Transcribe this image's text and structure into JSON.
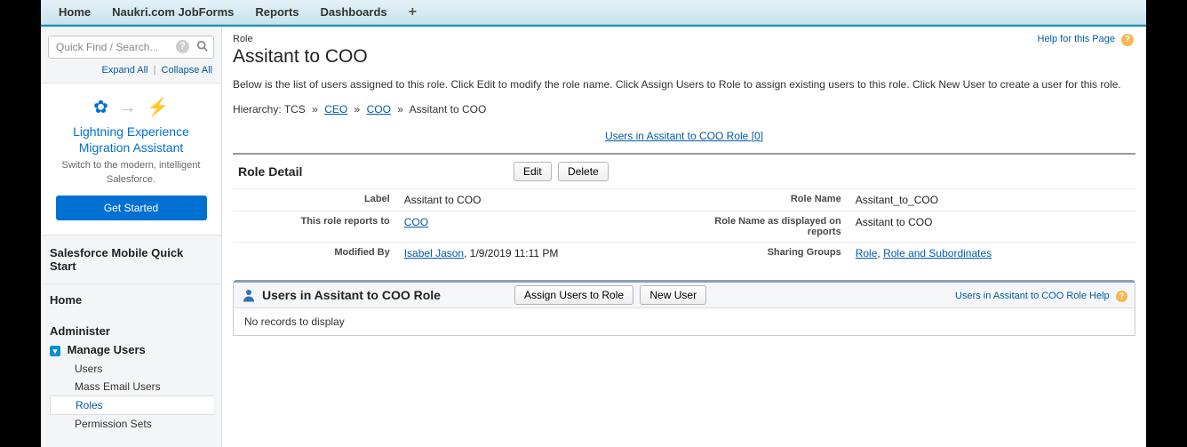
{
  "topnav": {
    "items": [
      "Home",
      "Naukri.com JobForms",
      "Reports",
      "Dashboards"
    ]
  },
  "search": {
    "placeholder": "Quick Find / Search..."
  },
  "expand": {
    "expand": "Expand All",
    "collapse": "Collapse All"
  },
  "migration": {
    "title": "Lightning Experience Migration Assistant",
    "subtitle": "Switch to the modern, intelligent Salesforce.",
    "cta": "Get Started"
  },
  "sfmqs": "Salesforce Mobile Quick Start",
  "sidenav": {
    "home": "Home",
    "administer": "Administer",
    "manage_users": "Manage Users",
    "items": [
      "Users",
      "Mass Email Users",
      "Roles",
      "Permission Sets"
    ],
    "active_index": 2
  },
  "page": {
    "help": "Help for this Page",
    "type_label": "Role",
    "title": "Assitant to COO",
    "description": "Below is the list of users assigned to this role. Click Edit to modify the role name. Click Assign Users to Role to assign existing users to this role. Click New User to create a user for this role.",
    "hierarchy": {
      "label": "Hierarchy:",
      "root": "TCS",
      "crumbs": [
        "CEO",
        "COO"
      ],
      "current": "Assitant to COO"
    },
    "users_link": "Users in Assitant to COO Role",
    "users_count": "[0]"
  },
  "detail": {
    "header": "Role Detail",
    "edit": "Edit",
    "delete": "Delete",
    "rows": {
      "label_lbl": "Label",
      "label_val": "Assitant to COO",
      "rolename_lbl": "Role Name",
      "rolename_val": "Assitant_to_COO",
      "reports_lbl": "This role reports to",
      "reports_val": "COO",
      "reportname_lbl": "Role Name as displayed on reports",
      "reportname_val": "Assitant to COO",
      "modby_lbl": "Modified By",
      "modby_user": "Isabel Jason",
      "modby_ts": ", 1/9/2019 11:11 PM",
      "sharing_lbl": "Sharing Groups",
      "sharing_a": "Role",
      "sharing_b": "Role and Subordinates"
    }
  },
  "userspanel": {
    "title": "Users in Assitant to COO Role",
    "assign": "Assign Users to Role",
    "newuser": "New User",
    "help": "Users in Assitant to COO Role Help",
    "empty": "No records to display"
  }
}
